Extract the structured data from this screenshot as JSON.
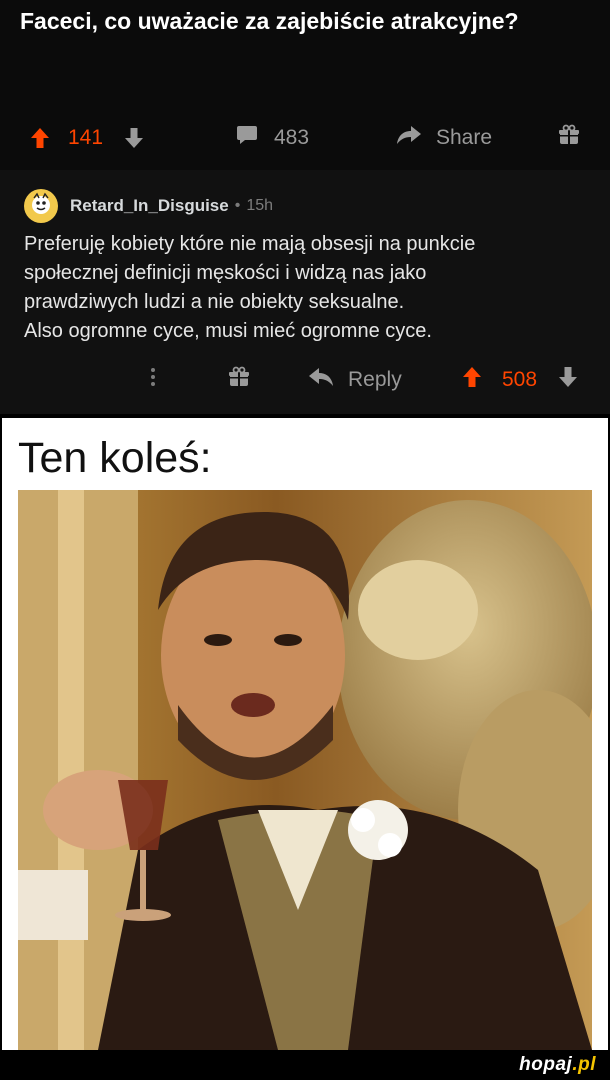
{
  "post": {
    "title": "Faceci, co uważacie za zajebiście atrakcyjne?",
    "upvotes": "141",
    "comments": "483",
    "share_label": "Share"
  },
  "comment": {
    "author": "Retard_In_Disguise",
    "separator": "•",
    "age": "15h",
    "lines": [
      "Preferuję kobiety które nie mają obsesji na punkcie",
      "społecznej definicji męskości i widzą nas jako",
      "prawdziwych ludzi a nie obiekty seksualne.",
      "Also ogromne cyce, musi mieć ogromne cyce."
    ],
    "reply_label": "Reply",
    "score": "508"
  },
  "meme": {
    "caption": "Ten koleś:"
  },
  "watermark": {
    "brand": "hopaj",
    "tld": ".pl"
  },
  "colors": {
    "accent_orange": "#ff4500",
    "muted_gray": "#9a9a9a",
    "background": "#0b0b0b"
  },
  "icons": [
    "arrow-up-icon",
    "arrow-down-icon",
    "comment-bubble-icon",
    "share-arrow-icon",
    "gift-icon",
    "more-dots-icon",
    "reply-arrow-icon",
    "avatar-icon"
  ]
}
